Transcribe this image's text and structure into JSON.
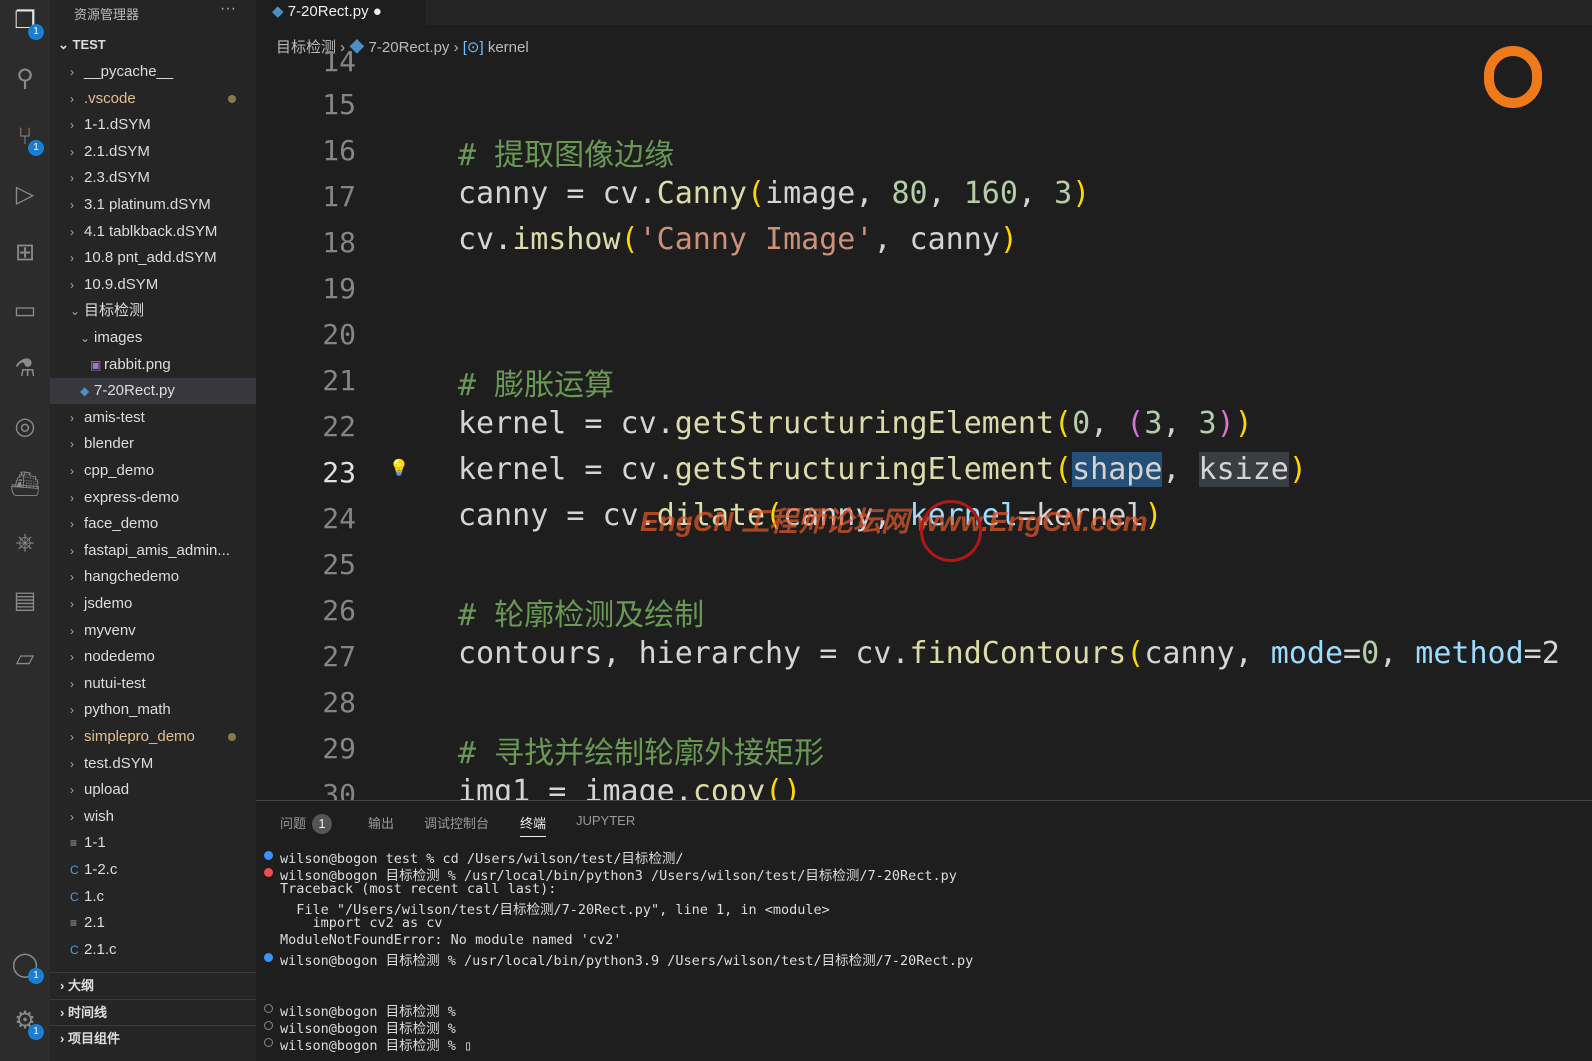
{
  "activity_bar": [
    {
      "icon": "files-icon",
      "glyph": "❐",
      "badge": "1"
    },
    {
      "icon": "search-icon",
      "glyph": "⚲"
    },
    {
      "icon": "source-control-icon",
      "glyph": "⑂",
      "badge": "1"
    },
    {
      "icon": "run-debug-icon",
      "glyph": "▷"
    },
    {
      "icon": "extensions-icon",
      "glyph": "⊞"
    },
    {
      "icon": "remote-explorer-icon",
      "glyph": "▭"
    },
    {
      "icon": "testing-icon",
      "glyph": "⚗"
    },
    {
      "icon": "fingerprint-icon",
      "glyph": "◎"
    },
    {
      "icon": "docker-icon",
      "glyph": "⛴"
    },
    {
      "icon": "kubernetes-icon",
      "glyph": "⎈"
    },
    {
      "icon": "notes-icon",
      "glyph": "▤"
    },
    {
      "icon": "folder-icon",
      "glyph": "▱"
    }
  ],
  "activity_bottom": [
    {
      "icon": "account-icon",
      "glyph": "◯",
      "badge": "1"
    },
    {
      "icon": "settings-gear-icon",
      "glyph": "⚙",
      "badge": "1"
    }
  ],
  "explorer": {
    "title": "资源管理器",
    "more": "···",
    "root": "TEST",
    "items": [
      {
        "label": "__pycache__",
        "type": "folder",
        "depth": 0
      },
      {
        "label": ".vscode",
        "type": "folder",
        "depth": 0,
        "modified": true
      },
      {
        "label": "1-1.dSYM",
        "type": "folder",
        "depth": 0
      },
      {
        "label": "2.1.dSYM",
        "type": "folder",
        "depth": 0
      },
      {
        "label": "2.3.dSYM",
        "type": "folder",
        "depth": 0
      },
      {
        "label": "3.1 platinum.dSYM",
        "type": "folder",
        "depth": 0
      },
      {
        "label": "4.1 tablkback.dSYM",
        "type": "folder",
        "depth": 0
      },
      {
        "label": "10.8 pnt_add.dSYM",
        "type": "folder",
        "depth": 0
      },
      {
        "label": "10.9.dSYM",
        "type": "folder",
        "depth": 0
      },
      {
        "label": "目标检测",
        "type": "open",
        "depth": 0
      },
      {
        "label": "images",
        "type": "open",
        "depth": 1
      },
      {
        "label": "rabbit.png",
        "type": "image",
        "depth": 2
      },
      {
        "label": "7-20Rect.py",
        "type": "py",
        "depth": 1,
        "selected": true
      },
      {
        "label": "amis-test",
        "type": "folder",
        "depth": 0
      },
      {
        "label": "blender",
        "type": "folder",
        "depth": 0
      },
      {
        "label": "cpp_demo",
        "type": "folder",
        "depth": 0
      },
      {
        "label": "express-demo",
        "type": "folder",
        "depth": 0
      },
      {
        "label": "face_demo",
        "type": "folder",
        "depth": 0
      },
      {
        "label": "fastapi_amis_admin...",
        "type": "folder",
        "depth": 0
      },
      {
        "label": "hangchedemo",
        "type": "folder",
        "depth": 0
      },
      {
        "label": "jsdemo",
        "type": "folder",
        "depth": 0
      },
      {
        "label": "myvenv",
        "type": "folder",
        "depth": 0
      },
      {
        "label": "nodedemo",
        "type": "folder",
        "depth": 0
      },
      {
        "label": "nutui-test",
        "type": "folder",
        "depth": 0
      },
      {
        "label": "python_math",
        "type": "folder",
        "depth": 0
      },
      {
        "label": "simplepro_demo",
        "type": "folder",
        "depth": 0,
        "modified": true
      },
      {
        "label": "test.dSYM",
        "type": "folder",
        "depth": 0
      },
      {
        "label": "upload",
        "type": "folder",
        "depth": 0
      },
      {
        "label": "wish",
        "type": "folder",
        "depth": 0
      },
      {
        "label": "1-1",
        "type": "text",
        "depth": 0
      },
      {
        "label": "1-2.c",
        "type": "c",
        "depth": 0
      },
      {
        "label": "1.c",
        "type": "c",
        "depth": 0
      },
      {
        "label": "2.1",
        "type": "text",
        "depth": 0
      },
      {
        "label": "2.1.c",
        "type": "c",
        "depth": 0
      }
    ],
    "sections": [
      "大纲",
      "时间线",
      "项目组件"
    ]
  },
  "tab": {
    "label": "7-20Rect.py",
    "dirty": "●"
  },
  "breadcrumb": [
    "目标检测",
    "7-20Rect.py",
    "kernel"
  ],
  "editor": {
    "current_line": 23,
    "lines": [
      {
        "n": 14,
        "t": []
      },
      {
        "n": 15,
        "t": []
      },
      {
        "n": 16,
        "t": [
          [
            "# 提取图像边缘",
            "c"
          ]
        ]
      },
      {
        "n": 17,
        "t": [
          [
            "canny = cv.",
            ""
          ],
          [
            "Canny",
            "f"
          ],
          [
            "(",
            "b"
          ],
          [
            "image, ",
            ""
          ],
          [
            "80",
            "n"
          ],
          [
            ", ",
            ""
          ],
          [
            "160",
            "n"
          ],
          [
            ", ",
            ""
          ],
          [
            "3",
            "n"
          ],
          [
            ")",
            "b"
          ]
        ]
      },
      {
        "n": 18,
        "t": [
          [
            "cv.",
            ""
          ],
          [
            "imshow",
            "f"
          ],
          [
            "(",
            "b"
          ],
          [
            "'Canny Image'",
            "s"
          ],
          [
            ", canny",
            ""
          ],
          [
            ")",
            "b"
          ]
        ]
      },
      {
        "n": 19,
        "t": []
      },
      {
        "n": 20,
        "t": []
      },
      {
        "n": 21,
        "t": [
          [
            "# 膨胀运算",
            "c"
          ]
        ]
      },
      {
        "n": 22,
        "t": [
          [
            "kernel = cv.",
            ""
          ],
          [
            "getStructuringElement",
            "f"
          ],
          [
            "(",
            "b"
          ],
          [
            "0",
            "n"
          ],
          [
            ", ",
            ""
          ],
          [
            "(",
            "p"
          ],
          [
            "3",
            "n"
          ],
          [
            ", ",
            ""
          ],
          [
            "3",
            "n"
          ],
          [
            ")",
            "p"
          ],
          [
            ")",
            "b"
          ]
        ]
      },
      {
        "n": 23,
        "t": [
          [
            "kernel = cv.",
            ""
          ],
          [
            "getStructuringElement",
            "f"
          ],
          [
            "(",
            "b"
          ],
          [
            "shape",
            "hl"
          ],
          [
            ", ",
            ""
          ],
          [
            "ksize",
            "hl2"
          ],
          [
            ")",
            "b"
          ]
        ]
      },
      {
        "n": 24,
        "t": [
          [
            "canny = cv.",
            ""
          ],
          [
            "dilate",
            "f"
          ],
          [
            "(",
            "b"
          ],
          [
            "canny, ",
            ""
          ],
          [
            "kernel",
            "v"
          ],
          [
            "=kernel",
            ""
          ],
          [
            ")",
            "b"
          ]
        ]
      },
      {
        "n": 25,
        "t": []
      },
      {
        "n": 26,
        "t": [
          [
            "# 轮廓检测及绘制",
            "c"
          ]
        ]
      },
      {
        "n": 27,
        "t": [
          [
            "contours, hierarchy = cv.",
            ""
          ],
          [
            "findContours",
            "f"
          ],
          [
            "(",
            "b"
          ],
          [
            "canny, ",
            ""
          ],
          [
            "mode",
            "v"
          ],
          [
            "=",
            ""
          ],
          [
            "0",
            "n"
          ],
          [
            ", ",
            ""
          ],
          [
            "method",
            "v"
          ],
          [
            "=2",
            ""
          ]
        ]
      },
      {
        "n": 28,
        "t": []
      },
      {
        "n": 29,
        "t": [
          [
            "# 寻找并绘制轮廓外接矩形",
            "c"
          ]
        ]
      },
      {
        "n": 30,
        "t": [
          [
            "img1 = image.",
            ""
          ],
          [
            "copy",
            "f"
          ],
          [
            "()",
            "b"
          ]
        ]
      }
    ]
  },
  "watermark": "EngCN 工程师论坛网 www.EngCN.com",
  "panel": {
    "tabs": [
      {
        "label": "问题",
        "badge": "1"
      },
      {
        "label": "输出"
      },
      {
        "label": "调试控制台"
      },
      {
        "label": "终端",
        "active": true
      },
      {
        "label": "JUPYTER"
      }
    ],
    "terminal": [
      {
        "status": "blue",
        "text": "wilson@bogon test % cd /Users/wilson/test/目标检测/"
      },
      {
        "status": "red",
        "text": "wilson@bogon 目标检测 % /usr/local/bin/python3 /Users/wilson/test/目标检测/7-20Rect.py"
      },
      {
        "text": "Traceback (most recent call last):"
      },
      {
        "text": "  File \"/Users/wilson/test/目标检测/7-20Rect.py\", line 1, in <module>"
      },
      {
        "text": "    import cv2 as cv"
      },
      {
        "text": "ModuleNotFoundError: No module named 'cv2'"
      },
      {
        "status": "blue",
        "text": "wilson@bogon 目标检测 % /usr/local/bin/python3.9 /Users/wilson/test/目标检测/7-20Rect.py"
      },
      {
        "text": ""
      },
      {
        "text": ""
      },
      {
        "status": "empty",
        "text": "wilson@bogon 目标检测 %"
      },
      {
        "status": "empty",
        "text": "wilson@bogon 目标检测 %"
      },
      {
        "status": "empty",
        "text": "wilson@bogon 目标检测 % ▯"
      }
    ]
  }
}
